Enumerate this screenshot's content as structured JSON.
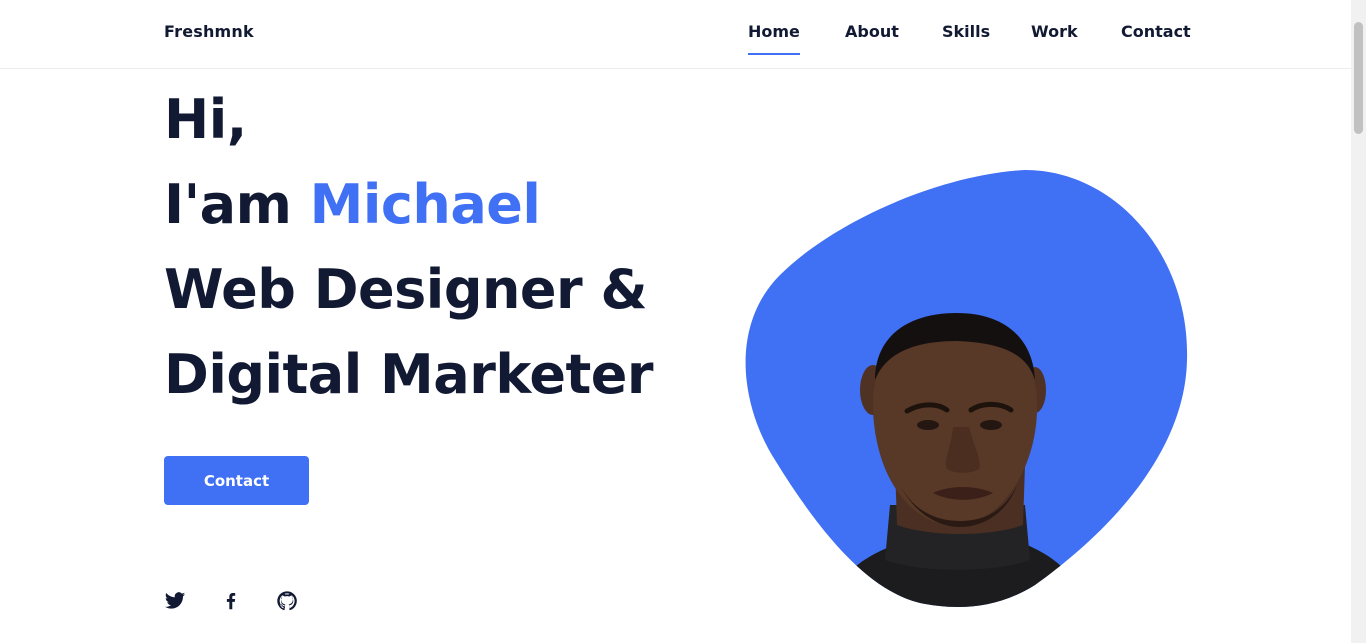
{
  "brand": {
    "name": "Freshmnk"
  },
  "nav": {
    "items": [
      {
        "label": "Home",
        "active": true
      },
      {
        "label": "About",
        "active": false
      },
      {
        "label": "Skills",
        "active": false
      },
      {
        "label": "Work",
        "active": false
      },
      {
        "label": "Contact",
        "active": false
      }
    ]
  },
  "hero": {
    "greeting": "Hi,",
    "intro_prefix": "I'am ",
    "name": "Michael",
    "role_line1": "Web Designer &",
    "role_line2": "Digital Marketer",
    "cta_label": "Contact"
  },
  "social": [
    {
      "icon": "twitter-icon"
    },
    {
      "icon": "facebook-icon"
    },
    {
      "icon": "github-icon"
    }
  ],
  "colors": {
    "accent": "#4070f4",
    "text": "#121a33",
    "background": "#ffffff"
  }
}
